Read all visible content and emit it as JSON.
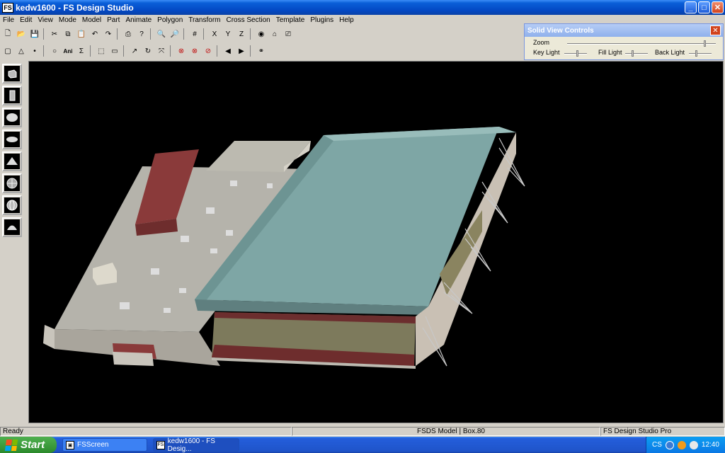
{
  "window": {
    "title": "kedw1600 - FS Design Studio",
    "icon_label": "FS",
    "controls": {
      "minimize": "_",
      "maximize": "□",
      "close": "✕"
    }
  },
  "menu": [
    "File",
    "Edit",
    "View",
    "Mode",
    "Model",
    "Part",
    "Animate",
    "Polygon",
    "Transform",
    "Cross Section",
    "Template",
    "Plugins",
    "Help"
  ],
  "toolbar1": [
    {
      "name": "new-file-icon",
      "glyph": "🗋"
    },
    {
      "name": "open-folder-icon",
      "glyph": "📂"
    },
    {
      "name": "save-icon",
      "glyph": "💾"
    },
    {
      "sep": true
    },
    {
      "name": "cut-icon",
      "glyph": "✂"
    },
    {
      "name": "copy-icon",
      "glyph": "⧉"
    },
    {
      "name": "paste-icon",
      "glyph": "📋"
    },
    {
      "name": "undo-icon",
      "glyph": "↶"
    },
    {
      "name": "redo-icon",
      "glyph": "↷"
    },
    {
      "sep": true
    },
    {
      "name": "print-icon",
      "glyph": "⎙"
    },
    {
      "name": "help-icon",
      "glyph": "?"
    },
    {
      "sep": true
    },
    {
      "name": "zoom-in-icon",
      "glyph": "🔍"
    },
    {
      "name": "zoom-out-icon",
      "glyph": "🔎"
    },
    {
      "sep": true
    },
    {
      "name": "grid-icon",
      "glyph": "#"
    },
    {
      "sep": true
    },
    {
      "name": "axis-x-icon",
      "glyph": "X"
    },
    {
      "name": "axis-y-icon",
      "glyph": "Y"
    },
    {
      "name": "axis-z-icon",
      "glyph": "Z"
    },
    {
      "sep": true
    },
    {
      "name": "solid-view-icon",
      "glyph": "◉"
    },
    {
      "name": "home-view-icon",
      "glyph": "⌂"
    },
    {
      "name": "camera-icon",
      "glyph": "⎚"
    }
  ],
  "toolbar2": [
    {
      "name": "select-box-icon",
      "glyph": "▢"
    },
    {
      "name": "triangle-icon",
      "glyph": "△"
    },
    {
      "name": "point-icon",
      "glyph": "•"
    },
    {
      "sep": true
    },
    {
      "name": "circle-icon",
      "glyph": "○"
    },
    {
      "name": "animate-icon",
      "glyph": "Ani",
      "txt": true
    },
    {
      "name": "sum-icon",
      "glyph": "Σ"
    },
    {
      "sep": true
    },
    {
      "name": "marquee-icon",
      "glyph": "⬚"
    },
    {
      "name": "ruler-icon",
      "glyph": "▭"
    },
    {
      "sep": true
    },
    {
      "name": "move-icon",
      "glyph": "↗"
    },
    {
      "name": "rotate-icon",
      "glyph": "↻"
    },
    {
      "name": "scale-icon",
      "glyph": "⤧"
    },
    {
      "sep": true
    },
    {
      "name": "delete-icon",
      "glyph": "⊗",
      "red": true
    },
    {
      "name": "delete-part-icon",
      "glyph": "⊗",
      "red": true
    },
    {
      "name": "delete-poly-icon",
      "glyph": "⊘",
      "red": true
    },
    {
      "sep": true
    },
    {
      "name": "previous-icon",
      "glyph": "◀"
    },
    {
      "name": "next-icon",
      "glyph": "▶"
    },
    {
      "sep": true
    },
    {
      "name": "binoculars-icon",
      "glyph": "⚭"
    }
  ],
  "solid_view_controls": {
    "title": "Solid View Controls",
    "close": "✕",
    "zoom_label": "Zoom",
    "zoom_level": 0.93,
    "key_light_label": "Key Light",
    "key_light_level": 0.6,
    "fill_light_label": "Fill Light",
    "fill_light_level": 0.3,
    "back_light_label": "Back Light",
    "back_light_level": 0.3
  },
  "primitives": [
    "cube-primitive-icon",
    "cylinder-primitive-icon",
    "sphere-primitive-icon",
    "disc-primitive-icon",
    "pyramid-primitive-icon",
    "geosphere-primitive-icon",
    "globe-primitive-icon",
    "dome-primitive-icon"
  ],
  "status": {
    "ready": "Ready",
    "model": "FSDS Model | Box.80",
    "product": "FS Design Studio Pro"
  },
  "taskbar": {
    "start": "Start",
    "tasks": [
      {
        "label": "FSScreen",
        "icon": "▣"
      },
      {
        "label": "kedw1600 - FS Desig...",
        "icon": "FS"
      }
    ],
    "tray_text": "CS",
    "clock": "12:40"
  },
  "colors": {
    "titlebar": "#0348c4",
    "viewport_bg": "#000000",
    "roof_teal": "#7fa6a6",
    "roof_red": "#8a3a3a",
    "flat_roof": "#b6b6ae"
  }
}
